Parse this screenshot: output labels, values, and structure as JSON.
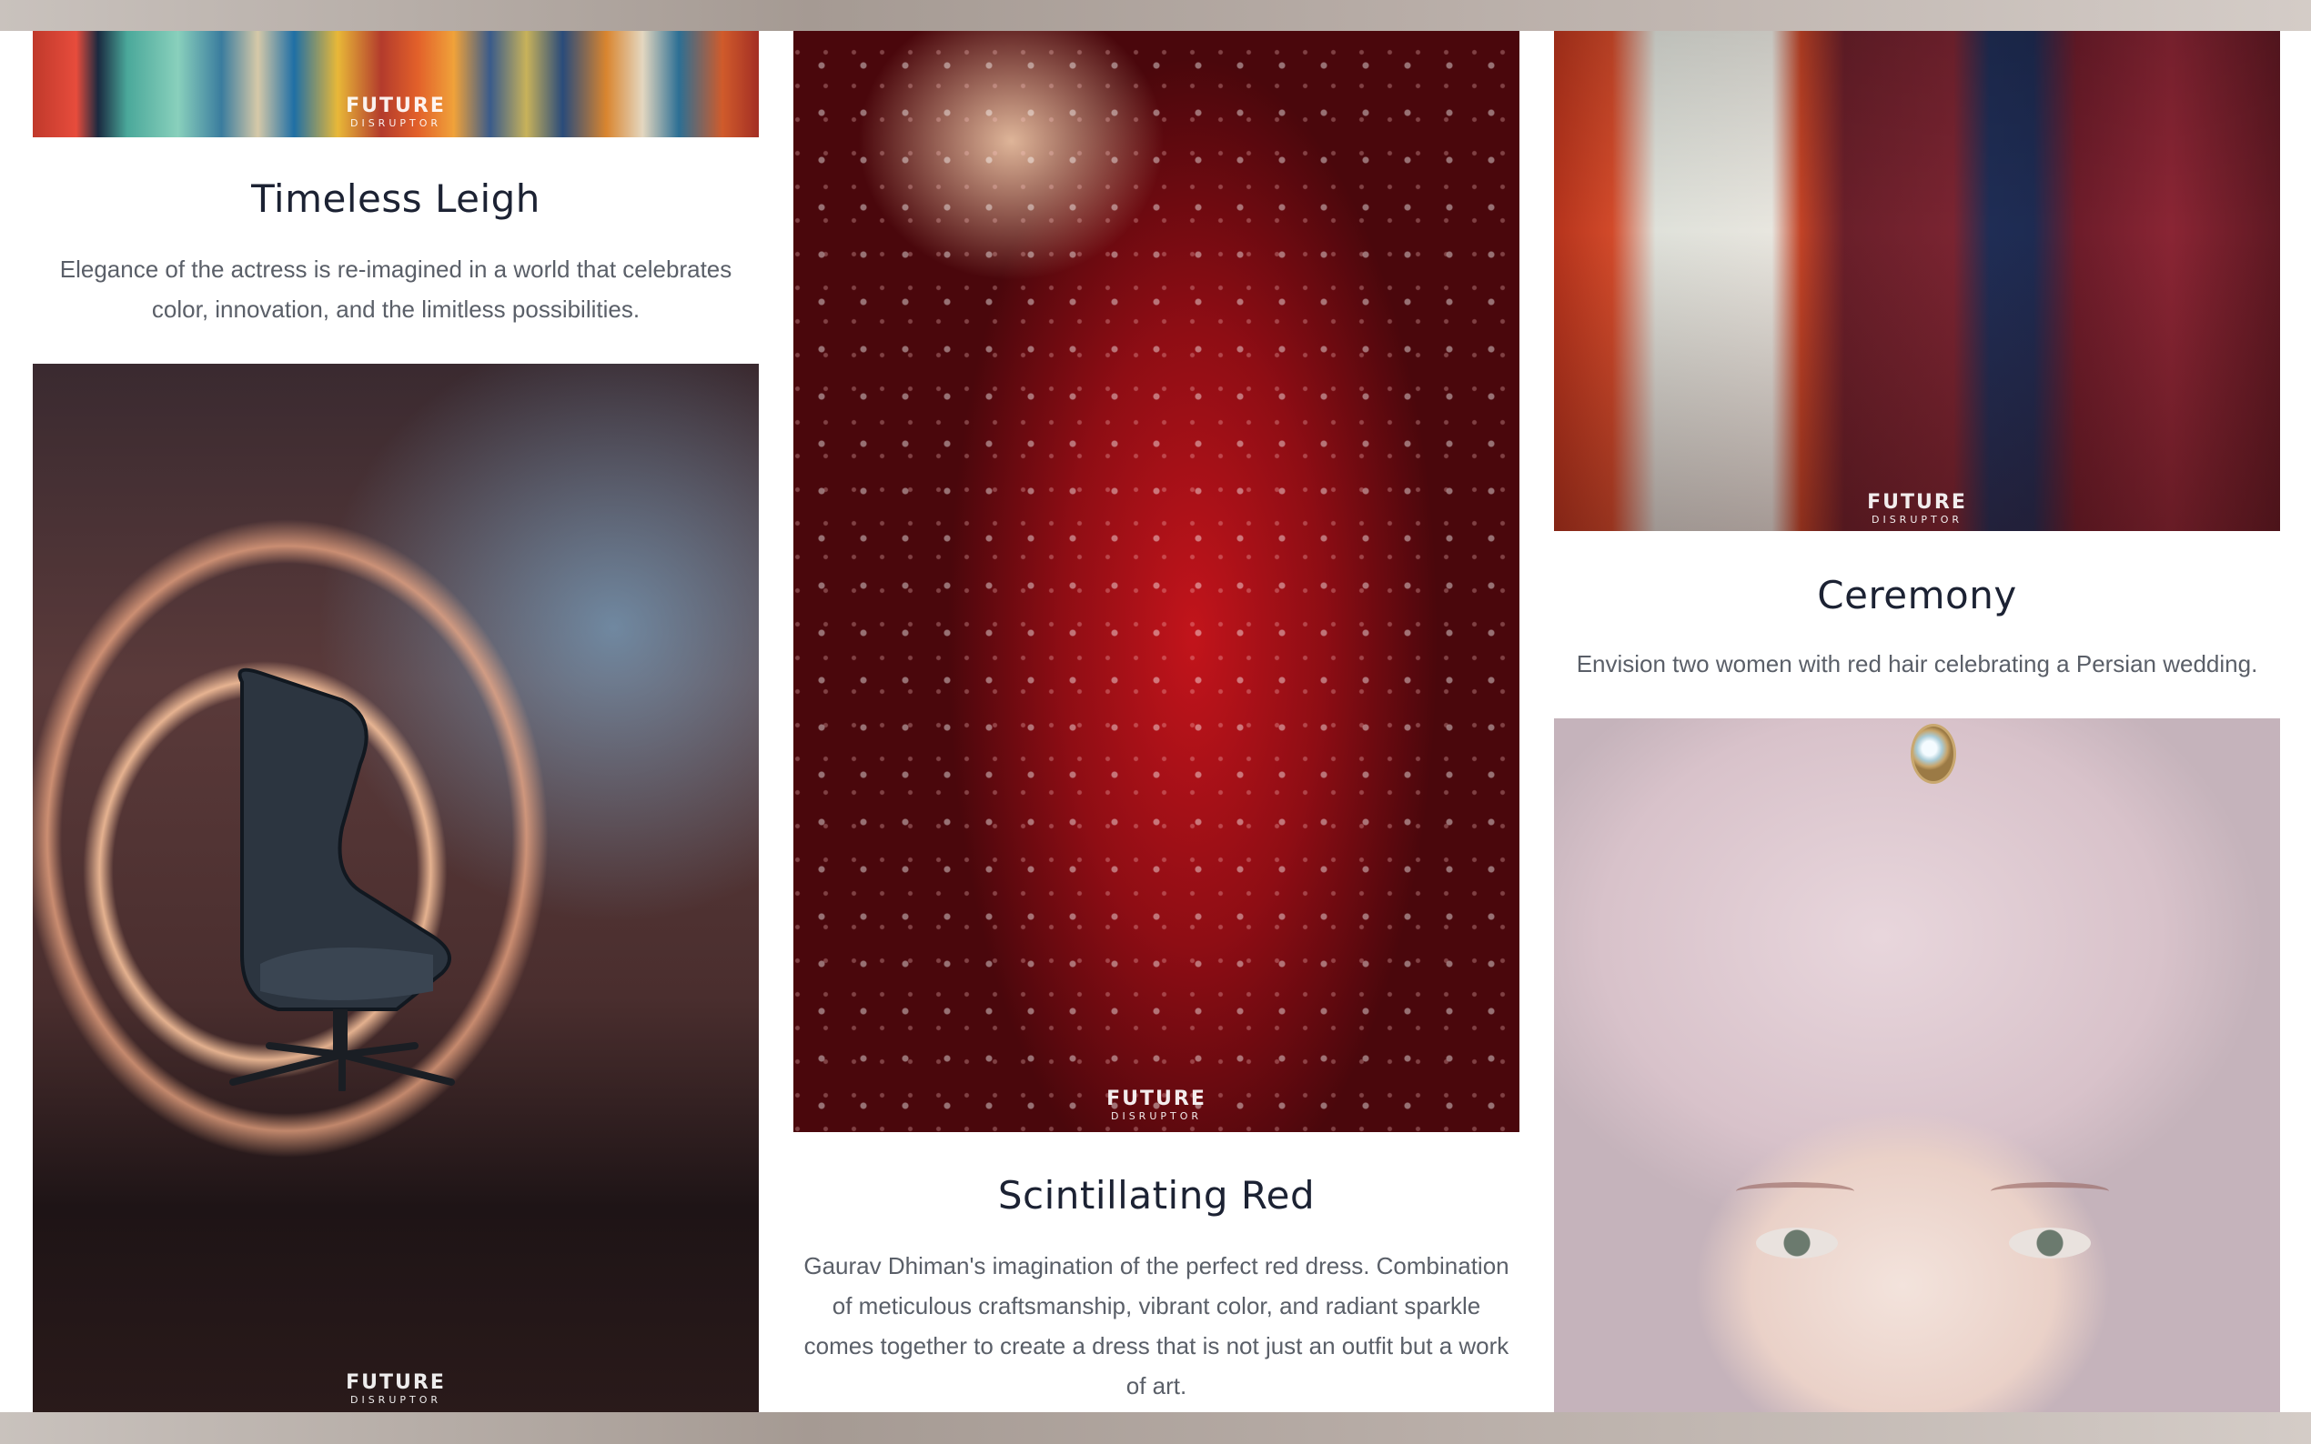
{
  "watermark": {
    "line1": "FUTURE",
    "line2": "DISRUPTOR"
  },
  "cards": {
    "timeless": {
      "title": "Timeless Leigh",
      "description": "Elegance of the actress is re-imagined in a world that celebrates color, innovation, and the limitless possibilities."
    },
    "chair": {
      "title": ""
    },
    "red": {
      "title": "Scintillating Red",
      "description": "Gaurav Dhiman's imagination of the perfect red dress. Combination of meticulous craftsmanship, vibrant color, and radiant sparkle comes together to create a dress that is not just an outfit but a work of art."
    },
    "ceremony": {
      "title": "Ceremony",
      "description": "Envision two women with red hair celebrating a Persian wedding."
    }
  },
  "colors": {
    "title": "#1c2233",
    "description": "#5a5f68",
    "background": "#ffffff"
  }
}
